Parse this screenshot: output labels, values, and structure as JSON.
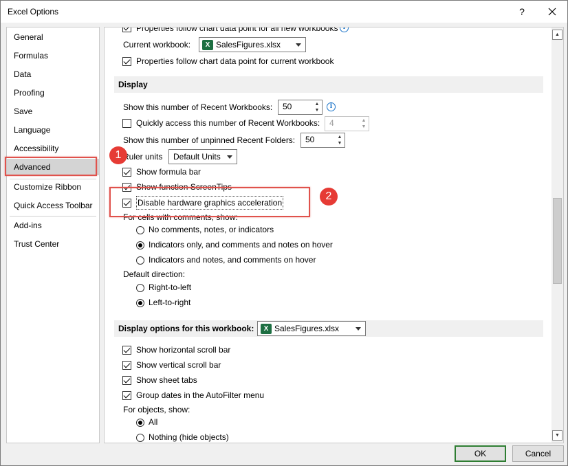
{
  "window": {
    "title": "Excel Options",
    "help": "?",
    "ok_label": "OK",
    "cancel_label": "Cancel"
  },
  "sidebar": {
    "items": [
      {
        "label": "General"
      },
      {
        "label": "Formulas"
      },
      {
        "label": "Data"
      },
      {
        "label": "Proofing"
      },
      {
        "label": "Save"
      },
      {
        "label": "Language"
      },
      {
        "label": "Accessibility"
      },
      {
        "label": "Advanced"
      },
      {
        "label": "Customize Ribbon"
      },
      {
        "label": "Quick Access Toolbar"
      },
      {
        "label": "Add-ins"
      },
      {
        "label": "Trust Center"
      }
    ],
    "selected": "Advanced"
  },
  "charts": {
    "top_cut_text": "Properties follow chart data point for all new workbooks",
    "current_workbook_label": "Current workbook:",
    "current_workbook_value": "SalesFigures.xlsx",
    "follow_current": "Properties follow chart data point for current workbook"
  },
  "display": {
    "header": "Display",
    "recent_workbooks_label": "Show this number of Recent Workbooks:",
    "recent_workbooks_value": "50",
    "quick_access_label": "Quickly access this number of Recent Workbooks:",
    "quick_access_value": "4",
    "recent_folders_label": "Show this number of unpinned Recent Folders:",
    "recent_folders_value": "50",
    "ruler_units_label": "Ruler units",
    "ruler_units_value": "Default Units",
    "show_formula_bar": "Show formula bar",
    "show_function_screentips": "Show function ScreenTips",
    "disable_hw_accel": "Disable hardware graphics acceleration",
    "comments_label": "For cells with comments, show:",
    "comments_opt1": "No comments, notes, or indicators",
    "comments_opt2": "Indicators only, and comments and notes on hover",
    "comments_opt3": "Indicators and notes, and comments on hover",
    "direction_label": "Default direction:",
    "direction_rtl": "Right-to-left",
    "direction_ltr": "Left-to-right"
  },
  "workbook_display": {
    "header": "Display options for this workbook:",
    "workbook_value": "SalesFigures.xlsx",
    "h_scroll": "Show horizontal scroll bar",
    "v_scroll": "Show vertical scroll bar",
    "sheet_tabs": "Show sheet tabs",
    "group_dates": "Group dates in the AutoFilter menu",
    "objects_label": "For objects, show:",
    "objects_all": "All",
    "objects_nothing": "Nothing (hide objects)"
  },
  "annotations": {
    "badge1": "1",
    "badge2": "2"
  },
  "colors": {
    "highlight": "#e0524c",
    "badge": "#e63b35",
    "excel_green": "#1d6f42"
  }
}
